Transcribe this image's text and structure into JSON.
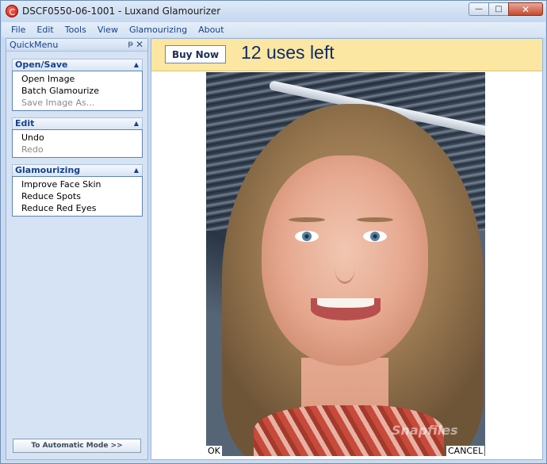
{
  "window": {
    "title": "DSCF0550-06-1001 - Luxand Glamourizer",
    "minimize_glyph": "—",
    "maximize_glyph": "□",
    "close_glyph": "✕"
  },
  "menu": [
    "File",
    "Edit",
    "Tools",
    "View",
    "Glamourizing",
    "About"
  ],
  "sidebar": {
    "title": "QuickMenu",
    "pin_glyph": "ᵽ",
    "close_glyph": "✕",
    "groups": [
      {
        "title": "Open/Save",
        "items": [
          {
            "label": "Open Image",
            "enabled": true
          },
          {
            "label": "Batch Glamourize",
            "enabled": true
          },
          {
            "label": "Save Image As...",
            "enabled": false
          }
        ]
      },
      {
        "title": "Edit",
        "items": [
          {
            "label": "Undo",
            "enabled": true
          },
          {
            "label": "Redo",
            "enabled": false
          }
        ]
      },
      {
        "title": "Glamourizing",
        "items": [
          {
            "label": "Improve Face Skin",
            "enabled": true
          },
          {
            "label": "Reduce Spots",
            "enabled": true
          },
          {
            "label": "Reduce Red Eyes",
            "enabled": true
          }
        ]
      }
    ],
    "auto_mode_label": "To Automatic Mode >>"
  },
  "promo": {
    "buy_label": "Buy Now",
    "uses_left": "12 uses left"
  },
  "photo": {
    "ok_label": "OK",
    "cancel_label": "CANCEL",
    "watermark": "Snapfiles"
  },
  "colors": {
    "accent": "#15428b",
    "promo_bg": "#fbe6a2",
    "frame": "#c9daef"
  }
}
